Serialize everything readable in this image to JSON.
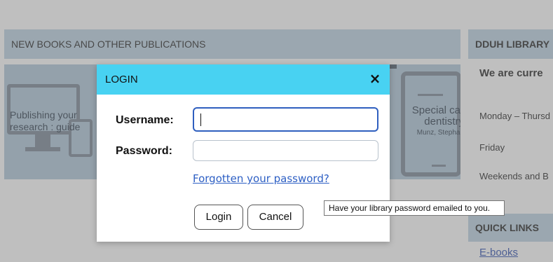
{
  "background": {
    "new_books_header": "NEW BOOKS AND OTHER PUBLICATIONS",
    "library_header": "DDUH LIBRARY",
    "book_left_title_line1": "Publishing your",
    "book_left_title_line2": "research : guide",
    "book_right_title_line1": "Special car",
    "book_right_title_line2": "dentistry",
    "book_right_author": "Munz, Stephan",
    "library_status": "We are curre",
    "hours_weekdays": "Monday – Thursd",
    "hours_friday": "Friday",
    "hours_weekends": "Weekends and B",
    "quick_links_header": "QUICK LINKS",
    "ebooks_link": "E-books"
  },
  "dialog": {
    "title": "LOGIN",
    "close_label": "×",
    "username_label": "Username:",
    "password_label": "Password:",
    "username_value": "",
    "password_value": "",
    "forgot_link": "Forgotten your password?",
    "login_button": "Login",
    "cancel_button": "Cancel"
  },
  "tooltip": {
    "text": "Have your library password emailed to you."
  },
  "colors": {
    "dialog_header": "#48d2f2",
    "section_header": "#b7cfe0",
    "link": "#2d5fc4",
    "focus_border": "#2f5fbf"
  }
}
